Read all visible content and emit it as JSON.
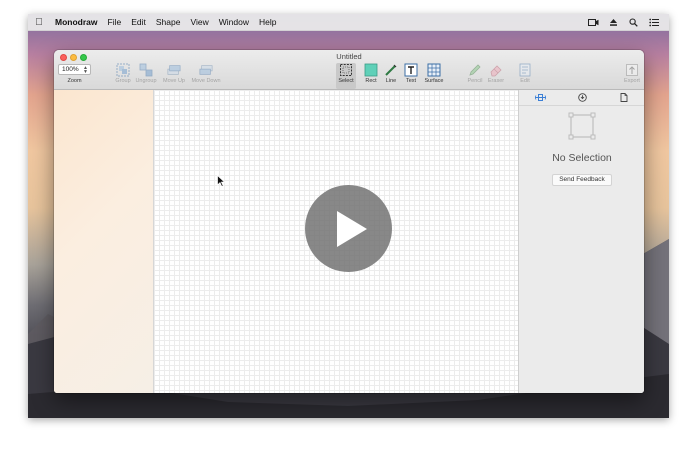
{
  "menubar": {
    "app_name": "Monodraw",
    "items": [
      "File",
      "Edit",
      "Shape",
      "View",
      "Window",
      "Help"
    ],
    "right_icons": [
      "screen-record-icon",
      "eject-icon",
      "spotlight-icon",
      "notification-center-icon"
    ]
  },
  "window": {
    "title": "Untitled",
    "zoom": {
      "value": "100%",
      "label": "Zoom"
    },
    "toolbar": {
      "group": "Group",
      "ungroup": "Ungroup",
      "move_up": "Move Up",
      "move_down": "Move Down",
      "select": "Select",
      "rect": "Rect",
      "line": "Line",
      "text": "Text",
      "surface": "Surface",
      "pencil": "Pencil",
      "eraser": "Eraser",
      "edit": "Edit",
      "export": "Export"
    },
    "inspector": {
      "tabs": [
        "style-inspector-icon",
        "info-icon",
        "document-icon"
      ],
      "empty_title": "No Selection",
      "feedback_label": "Send Feedback"
    }
  },
  "colors": {
    "rect_fill": "#5fd0b8",
    "accent": "#3b7fd6"
  },
  "video_overlay": {
    "icon": "play-icon"
  }
}
